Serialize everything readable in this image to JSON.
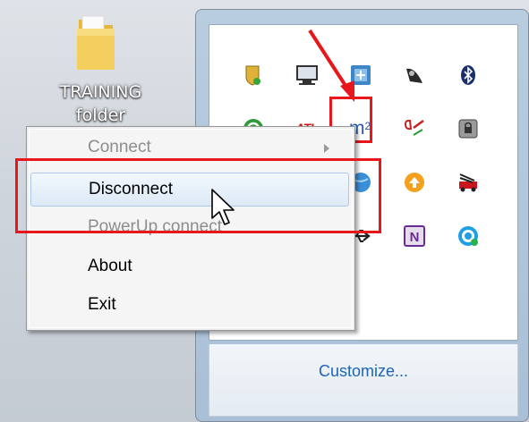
{
  "desktop": {
    "folder": {
      "label_line1": "TRAINING",
      "label_line2": "folder",
      "icon": "folder-icon"
    }
  },
  "tray": {
    "icons": [
      {
        "name": "shield-security-icon"
      },
      {
        "name": "monitor-display-icon"
      },
      {
        "name": "network-map-icon"
      },
      {
        "name": "satellite-dish-icon"
      },
      {
        "name": "bluetooth-icon"
      },
      {
        "name": "sync-refresh-icon"
      },
      {
        "name": "ati-catalyst-icon",
        "text": "ATI"
      },
      {
        "name": "m2-icon",
        "text": "m",
        "sup": "2"
      },
      {
        "name": "code-bracket-icon"
      },
      {
        "name": "lock-drive-icon"
      },
      {
        "name": "globe-icon"
      },
      {
        "name": "upload-arrow-icon"
      },
      {
        "name": "fire-truck-icon"
      },
      {
        "name": "usb-icon"
      },
      {
        "name": "onenote-icon",
        "text": "N"
      },
      {
        "name": "skype-icon"
      }
    ],
    "customize_label": "Customize..."
  },
  "context_menu": {
    "items": [
      {
        "label": "Connect",
        "enabled": false,
        "has_submenu": true
      },
      {
        "label": "Disconnect",
        "enabled": true,
        "highlighted": true
      },
      {
        "label": "PowerUp connect",
        "enabled": false
      },
      {
        "label": "About",
        "enabled": true
      },
      {
        "label": "Exit",
        "enabled": true
      }
    ]
  },
  "colors": {
    "annotation_red": "#e8171b",
    "link_blue": "#1e64b4",
    "menu_highlight_border": "#a8cbed"
  }
}
